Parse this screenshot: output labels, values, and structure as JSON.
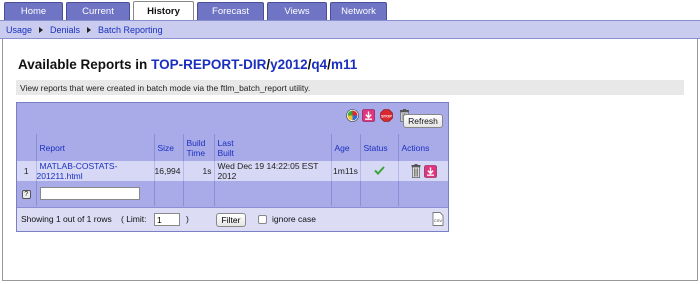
{
  "tabs": [
    {
      "label": "Home",
      "active": false
    },
    {
      "label": "Current",
      "active": false
    },
    {
      "label": "History",
      "active": true
    },
    {
      "label": "Forecast",
      "active": false
    },
    {
      "label": "Views",
      "active": false
    },
    {
      "label": "Network",
      "active": false
    }
  ],
  "breadcrumb": [
    "Usage",
    "Denials",
    "Batch Reporting"
  ],
  "page": {
    "title_prefix": "Available Reports in",
    "path_root": "TOP-REPORT-DIR",
    "path_year": "y2012",
    "path_quarter": "q4",
    "path_month": "m11",
    "slash": "/",
    "info": "View reports that were created in batch mode via the ftlm_batch_report utility."
  },
  "toolbar": {
    "refresh_label": "Refresh",
    "icons": [
      "rotate-icon",
      "download-icon",
      "stop-icon",
      "trash-icon"
    ]
  },
  "table": {
    "headers": {
      "report": "Report",
      "size": "Size",
      "build_time_1": "Build",
      "build_time_2": "Time",
      "last_built_1": "Last",
      "last_built_2": "Built",
      "age": "Age",
      "status": "Status",
      "actions": "Actions"
    },
    "rows": [
      {
        "index": "1",
        "report": "MATLAB-COSTATS-201211.html",
        "size": "16,994",
        "build_time": "1s",
        "last_built": "Wed Dec 19 14:22:05 EST 2012",
        "age": "1m11s",
        "status_icon": "check-icon",
        "status_color": "#3aa63a"
      }
    ],
    "filter_help_glyph": "?"
  },
  "footer": {
    "showing": "Showing 1 out of 1 rows",
    "limit_label": "( Limit:",
    "limit_value": "1",
    "limit_close": ")",
    "filter_label": "Filter",
    "ignore_case_label": "ignore case",
    "csv_label": "CSV"
  },
  "colors": {
    "tab_bg": "#6f74c5",
    "subnav_bg": "#c9ccef",
    "panel_bg": "#a8abe8",
    "row_bg": "#d6d8f5",
    "link": "#1b2fbf"
  }
}
